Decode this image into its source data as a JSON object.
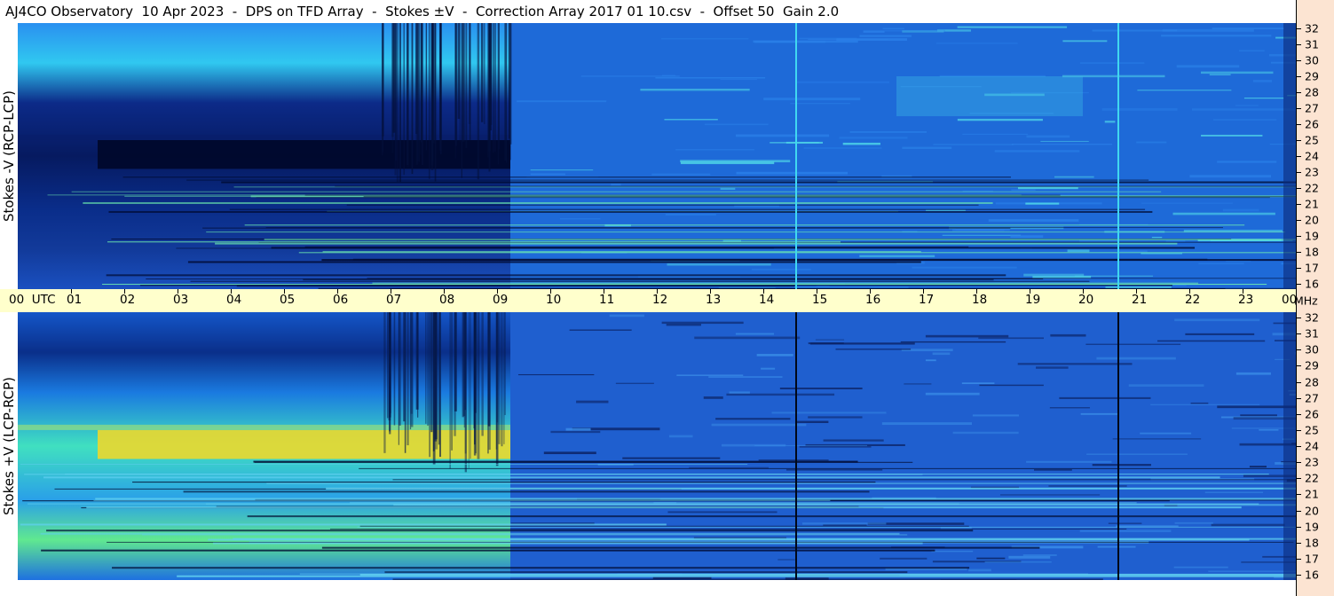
{
  "header": {
    "title": "AJ4CO Observatory  10 Apr 2023  -  DPS on TFD Array  -  Stokes ±V  -  Correction Array 2017 01 10.csv  -  Offset 50  Gain 2.0"
  },
  "colors": {
    "utc_bar": "#ffffcc",
    "mhz_strip": "#fce4d2",
    "low": "#000030",
    "mid": "#1e6adf",
    "high": "#f0d020"
  },
  "chart_data": {
    "type": "heatmap",
    "panels": [
      {
        "id": "top",
        "ylabel": "Stokes -V (RCP-LCP)"
      },
      {
        "id": "bottom",
        "ylabel": "Stokes +V (LCP-RCP)"
      }
    ],
    "x_axis": {
      "first_label": "00  UTC",
      "last_label": "00",
      "ticks": [
        "01",
        "02",
        "03",
        "04",
        "05",
        "06",
        "07",
        "08",
        "09",
        "10",
        "11",
        "12",
        "13",
        "14",
        "15",
        "16",
        "17",
        "18",
        "19",
        "20",
        "21",
        "22",
        "23"
      ],
      "range_hours": [
        0,
        24
      ]
    },
    "y_axis": {
      "unit": "MHz",
      "ticks": [
        "32",
        "31",
        "30",
        "29",
        "28",
        "27",
        "26",
        "25",
        "24",
        "23",
        "22",
        "21",
        "20",
        "19",
        "18",
        "17",
        "16"
      ],
      "range_mhz": [
        16,
        32
      ]
    },
    "features": {
      "vertical_lines_utc": [
        14.6,
        20.65
      ],
      "strong_band_utc": [
        1.5,
        9.25
      ],
      "strong_band_mhz": [
        23.2,
        25.0
      ]
    }
  }
}
